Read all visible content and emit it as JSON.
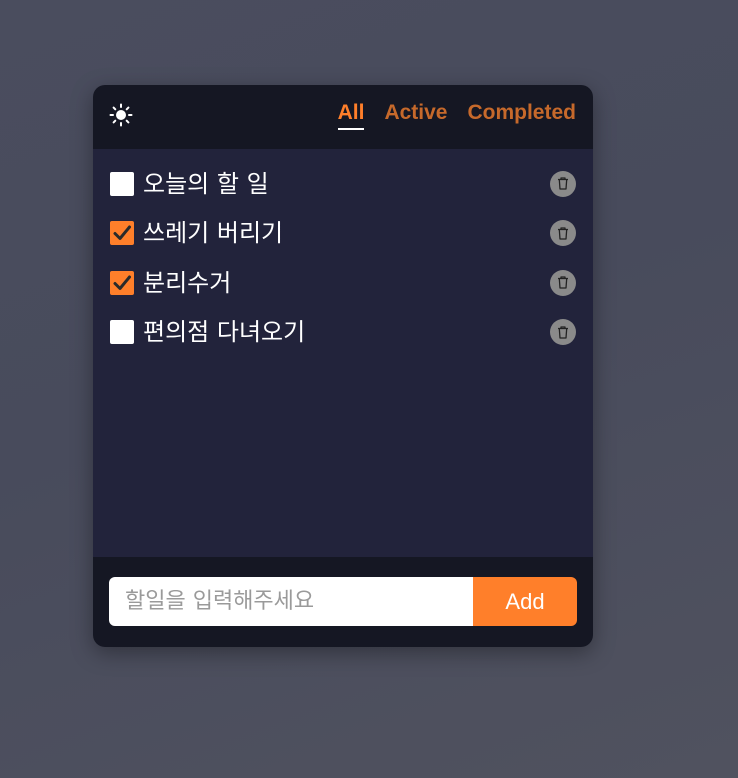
{
  "header": {
    "theme_icon": "sun-icon",
    "filters": [
      {
        "label": "All",
        "selected": true
      },
      {
        "label": "Active",
        "selected": false
      },
      {
        "label": "Completed",
        "selected": false
      }
    ]
  },
  "todos": [
    {
      "text": "오늘의 할 일",
      "done": false
    },
    {
      "text": "쓰레기 버리기",
      "done": true
    },
    {
      "text": "분리수거",
      "done": true
    },
    {
      "text": "편의점 다녀오기",
      "done": false
    }
  ],
  "form": {
    "placeholder": "할일을 입력해주세요",
    "value": "",
    "add_label": "Add"
  },
  "colors": {
    "accent": "#ff7f2a",
    "header_bg": "#151723",
    "list_bg": "#22233b",
    "delete_bg": "#8a8a8a"
  }
}
